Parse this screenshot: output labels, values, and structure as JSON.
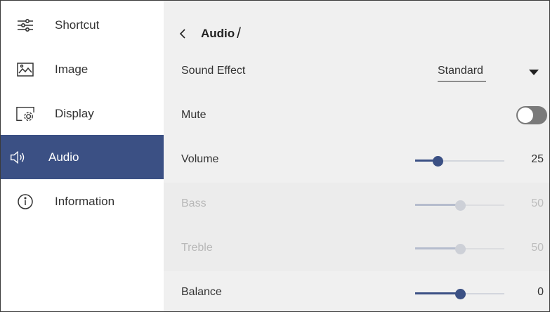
{
  "sidebar": {
    "items": [
      {
        "label": "Shortcut",
        "icon": "sliders-icon"
      },
      {
        "label": "Image",
        "icon": "image-icon"
      },
      {
        "label": "Display",
        "icon": "display-settings-icon"
      },
      {
        "label": "Audio",
        "icon": "speaker-icon",
        "active": true
      },
      {
        "label": "Information",
        "icon": "info-icon"
      }
    ]
  },
  "header": {
    "title": "Audio",
    "separator": "/"
  },
  "settings": {
    "sound_effect": {
      "label": "Sound Effect",
      "value": "Standard"
    },
    "mute": {
      "label": "Mute",
      "on": false
    },
    "volume": {
      "label": "Volume",
      "value": "25"
    },
    "bass": {
      "label": "Bass",
      "value": "50",
      "disabled": true
    },
    "treble": {
      "label": "Treble",
      "value": "50",
      "disabled": true
    },
    "balance": {
      "label": "Balance",
      "value": "0"
    }
  },
  "colors": {
    "accent": "#3b5084",
    "panel": "#f0f0f0",
    "sidebar": "#ffffff"
  }
}
